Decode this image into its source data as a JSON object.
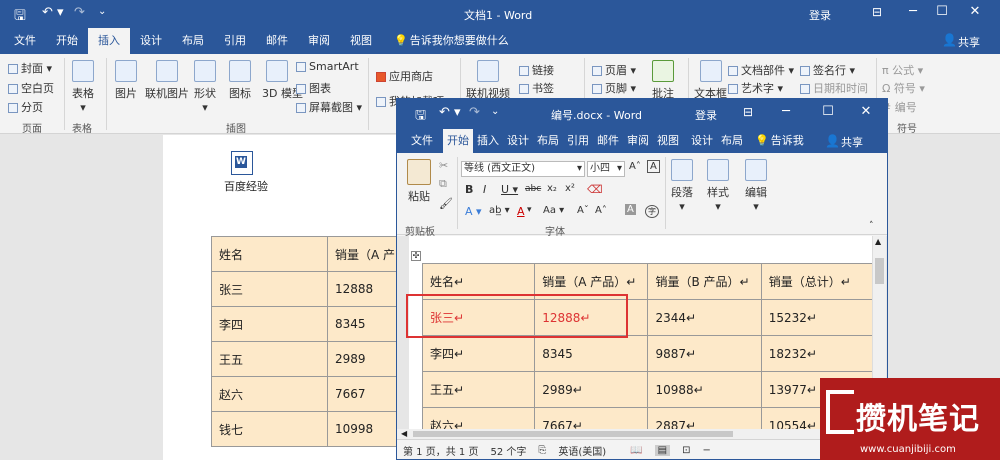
{
  "main": {
    "title": "文档1 - Word",
    "login": "登录",
    "share": "共享",
    "tabs": [
      "文件",
      "开始",
      "插入",
      "设计",
      "布局",
      "引用",
      "邮件",
      "审阅",
      "视图"
    ],
    "active_tab": "插入",
    "tellme": "告诉我你想要做什么",
    "ribbon": {
      "pages": [
        "封面",
        "空白页",
        "分页"
      ],
      "pages_group": "页面",
      "table": "表格",
      "table_group": "表格",
      "illus": [
        "图片",
        "联机图片",
        "形状",
        "图标",
        "3D 模型"
      ],
      "smartart": "SmartArt",
      "chart": "图表",
      "screenshot": "屏幕截图",
      "illus_group": "插图",
      "store": "应用商店",
      "my_addins": "我的加载项",
      "video": "联机视频",
      "link": "链接",
      "bookmark": "书签",
      "header": "页眉",
      "footer": "页脚",
      "comment": "批注",
      "textbox": "文本框",
      "docparts": "文档部件",
      "wordart": "艺术字",
      "signature": "签名行",
      "datetime": "日期和时间",
      "equation": "公式",
      "symbol": "符号",
      "number": "编号",
      "symbols_group": "符号"
    },
    "doc_icon_label": "百度经验",
    "table": {
      "headers": [
        "姓名",
        "销量（A 产"
      ],
      "rows": [
        [
          "张三",
          "12888"
        ],
        [
          "李四",
          "8345"
        ],
        [
          "王五",
          "2989"
        ],
        [
          "赵六",
          "7667"
        ],
        [
          "钱七",
          "10998"
        ]
      ]
    }
  },
  "win2": {
    "title": "编号.docx - Word",
    "login": "登录",
    "share": "共享",
    "tabs": [
      "文件",
      "开始",
      "插入",
      "设计",
      "布局",
      "引用",
      "邮件",
      "审阅",
      "视图",
      "设计",
      "布局"
    ],
    "tellme": "告诉我",
    "ribbon": {
      "paste": "粘贴",
      "clipboard": "剪贴板",
      "font_name": "等线 (西文正文)",
      "font_size": "小四",
      "font_group": "字体",
      "paragraph": "段落",
      "styles": "样式",
      "edit": "编辑"
    },
    "table": {
      "headers": [
        "姓名↵",
        "销量（A 产品）↵",
        "销量（B 产品）↵",
        "销量（总计）↵"
      ],
      "rows": [
        [
          "张三↵",
          "12888↵",
          "2344↵",
          "15232↵"
        ],
        [
          "李四↵",
          "8345",
          "9887↵",
          "18232↵"
        ],
        [
          "王五↵",
          "2989↵",
          "10988↵",
          "13977↵"
        ],
        [
          "赵六↵",
          "7667↵",
          "2887↵",
          "10554↵"
        ]
      ]
    },
    "status": {
      "page": "第 1 页，共 1 页",
      "words": "52 个字",
      "lang": "英语(美国)"
    },
    "highlight_color": "#d33"
  },
  "watermark": {
    "text": "攒机笔记",
    "url": "www.cuanjibiji.com"
  }
}
